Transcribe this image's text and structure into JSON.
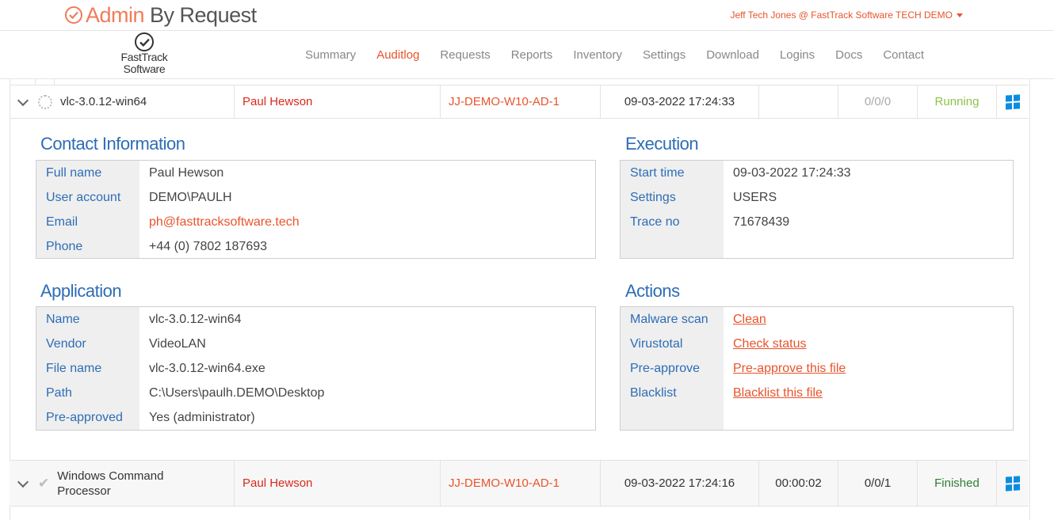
{
  "header": {
    "brand_admin": "Admin",
    "brand_rest": "By Request",
    "user": "Jeff Tech Jones @ FastTrack Software TECH DEMO"
  },
  "company_logo": {
    "line1": "FastTrack",
    "line2": "Software"
  },
  "nav": [
    {
      "label": "Summary"
    },
    {
      "label": "Auditlog",
      "active": true
    },
    {
      "label": "Requests"
    },
    {
      "label": "Reports"
    },
    {
      "label": "Inventory"
    },
    {
      "label": "Settings"
    },
    {
      "label": "Download"
    },
    {
      "label": "Logins"
    },
    {
      "label": "Docs"
    },
    {
      "label": "Contact"
    }
  ],
  "rows": [
    {
      "app": "vlc-3.0.12-win64",
      "user": "Paul Hewson",
      "computer": "JJ-DEMO-W10-AD-1",
      "time": "09-03-2022 17:24:33",
      "duration": "",
      "counts": "0/0/0",
      "status": "Running",
      "status_color": "#8cc34a",
      "os_icon": "windows-icon"
    },
    {
      "app": "Windows Command Processor",
      "user": "Paul Hewson",
      "computer": "JJ-DEMO-W10-AD-1",
      "time": "09-03-2022 17:24:16",
      "duration": "00:00:02",
      "counts": "0/0/1",
      "status": "Finished",
      "status_color": "#2e7d32",
      "os_icon": "windows-icon"
    }
  ],
  "details": {
    "contact": {
      "title": "Contact Information",
      "items": [
        {
          "k": "Full name",
          "v": "Paul Hewson"
        },
        {
          "k": "User account",
          "v": "DEMO\\PAULH"
        },
        {
          "k": "Email",
          "v": "ph@fasttracksoftware.tech"
        },
        {
          "k": "Phone",
          "v": "+44 (0) 7802 187693"
        }
      ]
    },
    "execution": {
      "title": "Execution",
      "items": [
        {
          "k": "Start time",
          "v": "09-03-2022 17:24:33"
        },
        {
          "k": "Settings",
          "v": "USERS"
        },
        {
          "k": "Trace no",
          "v": "71678439"
        }
      ]
    },
    "application": {
      "title": "Application",
      "items": [
        {
          "k": "Name",
          "v": "vlc-3.0.12-win64"
        },
        {
          "k": "Vendor",
          "v": "VideoLAN"
        },
        {
          "k": "File name",
          "v": "vlc-3.0.12-win64.exe"
        },
        {
          "k": "Path",
          "v": "C:\\Users\\paulh.DEMO\\Desktop"
        },
        {
          "k": "Pre-approved",
          "v": "Yes (administrator)"
        }
      ]
    },
    "actions": {
      "title": "Actions",
      "items": [
        {
          "k": "Malware scan",
          "v": "Clean"
        },
        {
          "k": "Virustotal",
          "v": "Check status"
        },
        {
          "k": "Pre-approve",
          "v": "Pre-approve this file"
        },
        {
          "k": "Blacklist",
          "v": "Blacklist this file"
        }
      ]
    }
  }
}
